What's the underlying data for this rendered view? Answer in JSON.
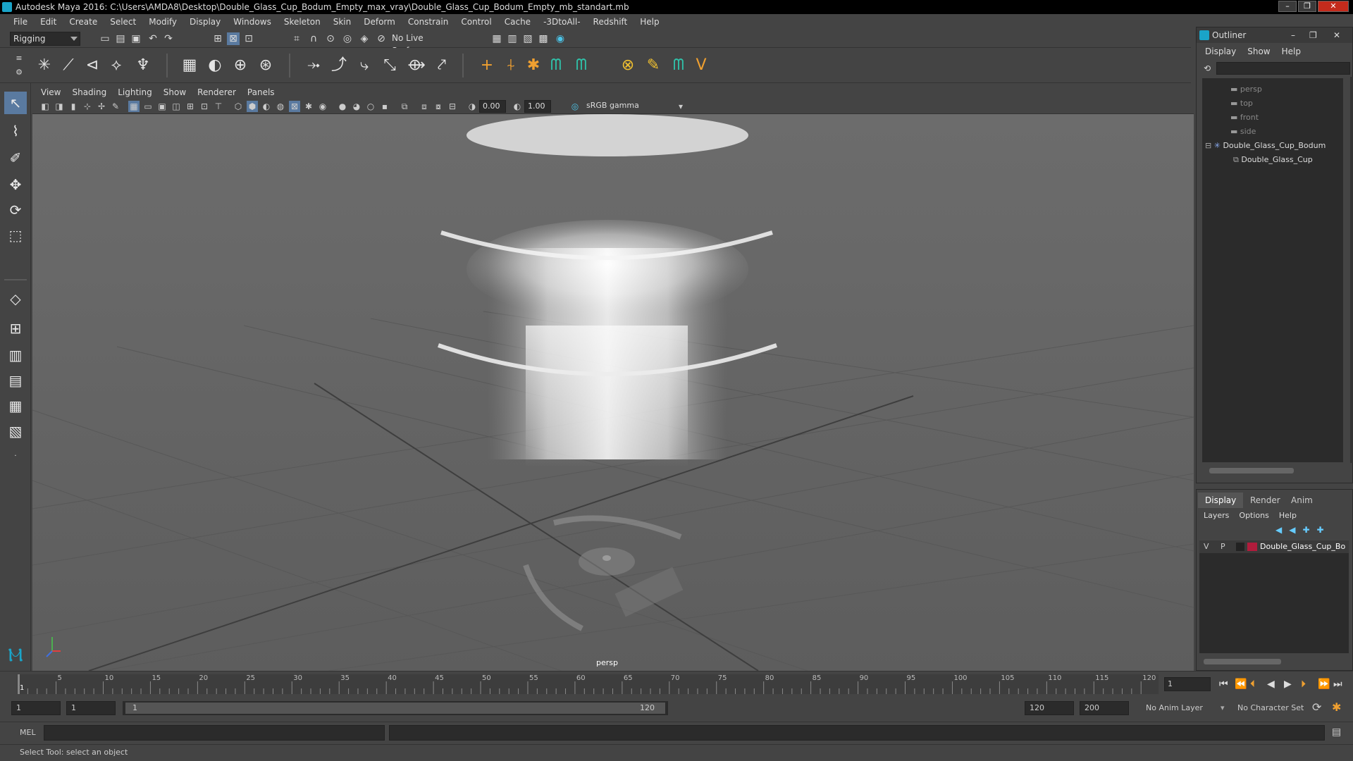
{
  "window": {
    "title": "Autodesk Maya 2016: C:\\Users\\AMDA8\\Desktop\\Double_Glass_Cup_Bodum_Empty_max_vray\\Double_Glass_Cup_Bodum_Empty_mb_standart.mb"
  },
  "menubar": [
    "File",
    "Edit",
    "Create",
    "Select",
    "Modify",
    "Display",
    "Windows",
    "Skeleton",
    "Skin",
    "Deform",
    "Constrain",
    "Control",
    "Cache",
    "-3DtoAll-",
    "Redshift",
    "Help"
  ],
  "statusline": {
    "mode": "Rigging",
    "live_surface": "No Live Surface"
  },
  "viewport": {
    "menu": [
      "View",
      "Shading",
      "Lighting",
      "Show",
      "Renderer",
      "Panels"
    ],
    "exposure": "0.00",
    "gamma": "1.00",
    "colorspace": "sRGB gamma",
    "camera_label": "persp"
  },
  "outliner": {
    "title": "Outliner",
    "menu": [
      "Display",
      "Show",
      "Help"
    ],
    "items": [
      {
        "label": "persp",
        "kind": "camera"
      },
      {
        "label": "top",
        "kind": "camera"
      },
      {
        "label": "front",
        "kind": "camera"
      },
      {
        "label": "side",
        "kind": "camera"
      },
      {
        "label": "Double_Glass_Cup_Bodum",
        "kind": "group"
      },
      {
        "label": "Double_Glass_Cup",
        "kind": "mesh"
      }
    ]
  },
  "layers": {
    "tabs": [
      "Display",
      "Render",
      "Anim"
    ],
    "menu": [
      "Layers",
      "Options",
      "Help"
    ],
    "row": {
      "v": "V",
      "p": "P",
      "name": "Double_Glass_Cup_Bo",
      "color": "#b01c3c"
    }
  },
  "timeline": {
    "ticks": [
      "5",
      "10",
      "15",
      "20",
      "25",
      "30",
      "35",
      "40",
      "45",
      "50",
      "55",
      "60",
      "65",
      "70",
      "75",
      "80",
      "85",
      "90",
      "95",
      "100",
      "105",
      "110",
      "115",
      "120"
    ],
    "start_tick": "1",
    "current_frame": "1"
  },
  "range": {
    "start": "1",
    "playback_start": "1",
    "slider_start": "1",
    "slider_end": "120",
    "playback_end": "120",
    "end": "200",
    "anim_layer": "No Anim Layer",
    "char_set": "No Character Set"
  },
  "cmdline": {
    "label": "MEL"
  },
  "helpline": {
    "text": "Select Tool: select an object"
  }
}
